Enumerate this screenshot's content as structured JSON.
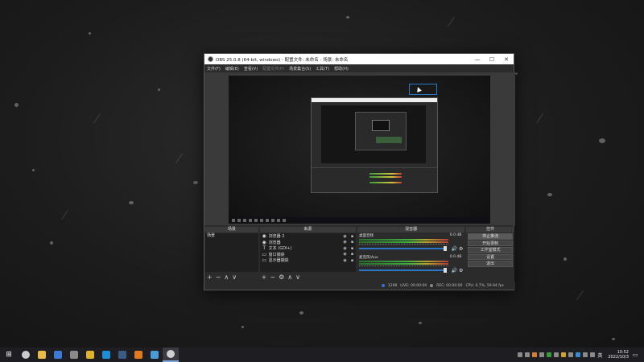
{
  "window": {
    "title": "OBS 25.0.8 (64-bit, windows) - 配置文件: 未命名 - 场景: 未命名",
    "minimize": "—",
    "maximize": "☐",
    "close": "✕"
  },
  "menu": [
    "文件(F)",
    "编辑(E)",
    "查看(V)",
    "配置文件(P)",
    "场景集合(S)",
    "工具(T)",
    "帮助(H)"
  ],
  "menu_disabled_index": 3,
  "docks": {
    "scenes": {
      "title": "场景",
      "items": [
        "场景"
      ],
      "footer": [
        "+",
        "−",
        "∧",
        "∨"
      ]
    },
    "sources": {
      "title": "来源",
      "items": [
        {
          "icon": "globe-icon",
          "glyph": "◉",
          "name": "浏览器 2"
        },
        {
          "icon": "globe-icon",
          "glyph": "◉",
          "name": "浏览器"
        },
        {
          "icon": "text-icon",
          "glyph": "T",
          "name": "文本 (GDI+)"
        },
        {
          "icon": "window-capture-icon",
          "glyph": "▭",
          "name": "窗口捕获"
        },
        {
          "icon": "display-capture-icon",
          "glyph": "▭",
          "name": "显示器捕获"
        }
      ],
      "footer": [
        "+",
        "−",
        "⚙",
        "∧",
        "∨"
      ]
    },
    "mixer": {
      "title": "混音器",
      "channels": [
        {
          "name": "桌面音频",
          "db": "0.0 dB"
        },
        {
          "name": "麦克风/Aux",
          "db": "0.0 dB"
        }
      ]
    },
    "controls": {
      "title": "控件",
      "buttons": [
        "停止推流",
        "开始录制",
        "工作室模式",
        "设置",
        "退出"
      ],
      "active_index": 0
    }
  },
  "status": {
    "live_label": "LIVE: 00:00:00",
    "dropped": "1298",
    "rec": "REC: 00:00:00",
    "cpu": "CPU: 0.7%, 59.94 fps"
  },
  "taskbar": {
    "clock_time": "10:52",
    "clock_date": "2022/10/3",
    "input_method": "英",
    "icons": [
      {
        "name": "search-icon",
        "color": "#cccccc"
      },
      {
        "name": "file-explorer-icon",
        "color": "#e8b84a"
      },
      {
        "name": "photos-icon",
        "color": "#3d7ad6"
      },
      {
        "name": "terminal-icon",
        "color": "#8a8a8a"
      },
      {
        "name": "app-yellow-icon",
        "color": "#e0b030"
      },
      {
        "name": "edge-icon",
        "color": "#1c8fd6"
      },
      {
        "name": "steam-icon",
        "color": "#3b5b85"
      },
      {
        "name": "app-orange-icon",
        "color": "#e07a20"
      },
      {
        "name": "browser-icon",
        "color": "#4a9ad8"
      },
      {
        "name": "obs-icon",
        "color": "#d0d0d0"
      }
    ]
  }
}
